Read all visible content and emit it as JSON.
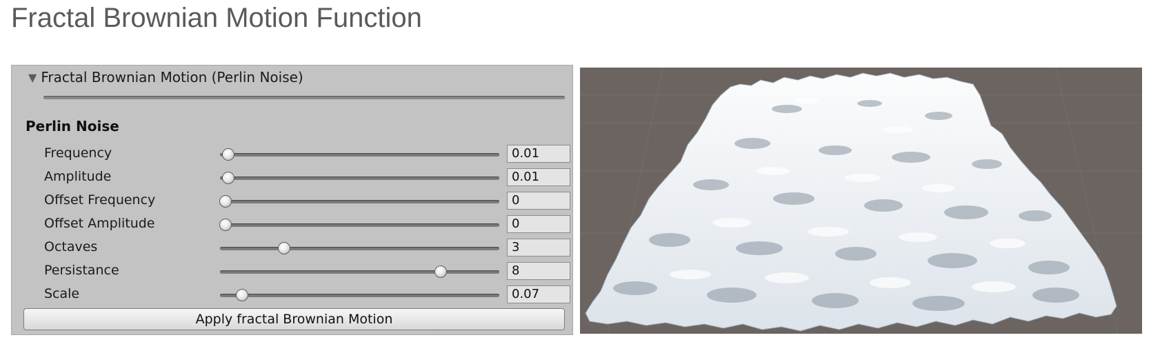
{
  "page_title": "Fractal Brownian Motion Function",
  "inspector": {
    "foldout_title": "Fractal Brownian Motion (Perlin Noise)",
    "section_title": "Perlin Noise",
    "rows": [
      {
        "label": "Frequency",
        "value": "0.01",
        "level": 0.03
      },
      {
        "label": "Amplitude",
        "value": "0.01",
        "level": 0.03
      },
      {
        "label": "Offset Frequency",
        "value": "0",
        "level": 0.02
      },
      {
        "label": "Offset Amplitude",
        "value": "0",
        "level": 0.02
      },
      {
        "label": "Octaves",
        "value": "3",
        "level": 0.23
      },
      {
        "label": "Persistance",
        "value": "8",
        "level": 0.79
      },
      {
        "label": "Scale",
        "value": "0.07",
        "level": 0.08
      }
    ],
    "apply_label": "Apply fractal Brownian Motion"
  },
  "viewport": {
    "background_color": "#6b6460",
    "terrain_color": "#f2f5f8",
    "shadow_color": "#5f6873"
  }
}
